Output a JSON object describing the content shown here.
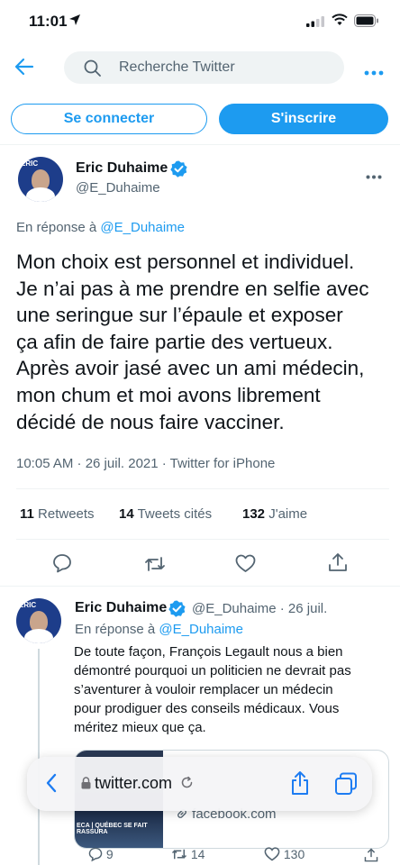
{
  "status": {
    "time": "11:01"
  },
  "search": {
    "placeholder": "Recherche Twitter"
  },
  "auth": {
    "login_label": "Se connecter",
    "signup_label": "S'inscrire"
  },
  "tweet": {
    "name": "Eric Duhaime",
    "handle": "@E_Duhaime",
    "reply_prefix": "En réponse à ",
    "reply_mention": "@E_Duhaime",
    "text_lines": [
      "Mon choix est personnel et individuel.",
      "Je n’ai pas à me prendre en selfie avec",
      "une seringue sur l’épaule et exposer",
      "ça afin de faire partie des vertueux.",
      "Après avoir jasé avec un ami médecin,",
      "mon chum et moi avons librement",
      "décidé de nous faire vacciner."
    ],
    "meta": "10:05 AM · 26 juil. 2021 · Twitter for iPhone",
    "retweets_count": "11",
    "retweets_label": " Retweets",
    "quotes_count": "14",
    "quotes_label": " Tweets cités",
    "likes_count": "132",
    "likes_label": " J'aime"
  },
  "reply": {
    "name": "Eric Duhaime",
    "handle_date": "@E_Duhaime · 26 juil.",
    "reply_prefix": "En réponse à ",
    "reply_mention": "@E_Duhaime",
    "text_lines": [
      "De toute façon, François Legault nous a bien",
      "démontré pourquoi un politicien ne devrait pas",
      "s’aventurer à vouloir remplacer un médecin",
      "pour prodiguer des conseils médicaux. Vous",
      "méritez mieux que ça."
    ],
    "card_domain": "facebook.com",
    "card_image_text": "ECA | QUÉBEC SE FAIT RASSURA",
    "reply_count": "9",
    "retweet_count": "14",
    "like_count": "130"
  },
  "avatar_logo": "ERIC",
  "browser": {
    "url": "twitter.com"
  },
  "colors": {
    "accent": "#1d9bf0",
    "text": "#0f1419",
    "secondary": "#536471"
  }
}
